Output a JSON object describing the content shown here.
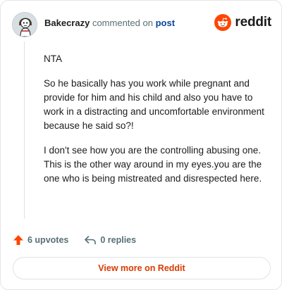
{
  "colors": {
    "accent": "#d93a00",
    "upvote": "#ff4500",
    "link": "#0a449b",
    "muted": "#576f76"
  },
  "header": {
    "username": "Bakecrazy",
    "action_text": "commented on",
    "post_link": "post",
    "brand_word": "reddit",
    "brand_icon": "reddit-snoo-icon",
    "avatar_icon": "user-avatar"
  },
  "comment": {
    "paragraphs": [
      "NTA",
      "So he basically has you work while pregnant and provide for him and his child and also you have to work in a distracting and uncomfortable environment because he said so?!",
      "I don't see how you are the controlling abusing one. This is the other way around in my eyes.you are the one who is being mistreated and disrespected here."
    ]
  },
  "footer": {
    "upvotes_label": "6 upvotes",
    "replies_label": "0 replies",
    "upvote_icon": "upvote-arrow-icon",
    "reply_icon": "reply-arrow-icon"
  },
  "cta": {
    "label": "View more on Reddit"
  }
}
